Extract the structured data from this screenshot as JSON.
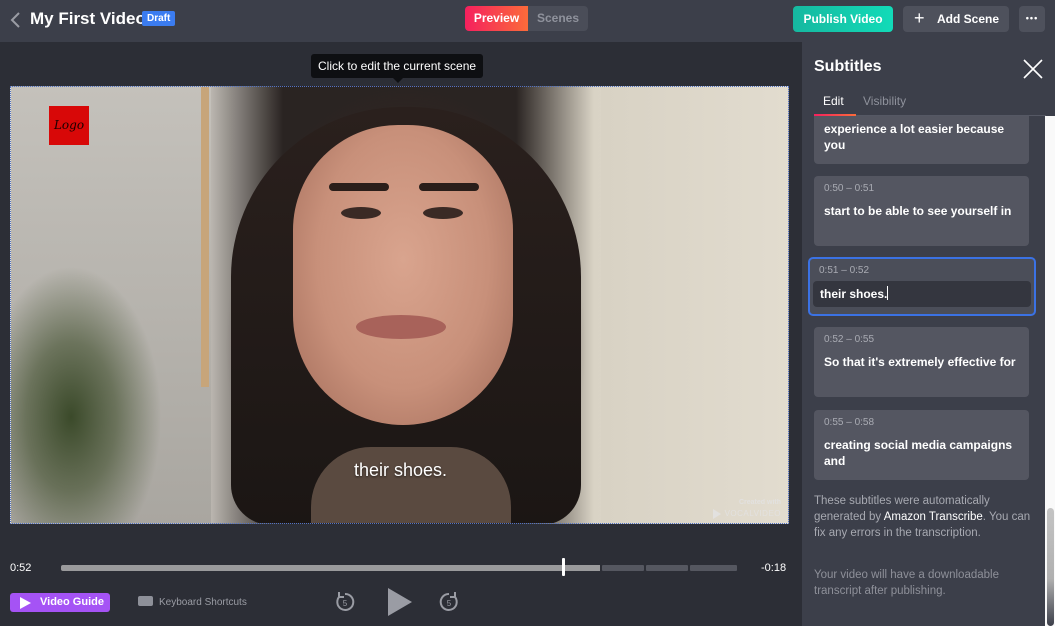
{
  "header": {
    "title": "My First Video",
    "status_badge": "Draft",
    "tabs": [
      {
        "label": "Preview",
        "active": true
      },
      {
        "label": "Scenes",
        "active": false
      }
    ],
    "publish_label": "Publish Video",
    "add_scene_label": "Add Scene",
    "more_label": "•••"
  },
  "stage": {
    "tooltip": "Click to edit the current scene",
    "video": {
      "logo_text": "Logo",
      "caption": "their shoes.",
      "watermark_line1": "Created with",
      "watermark_line2": "VOCALVIDEO"
    }
  },
  "player": {
    "current_time": "0:52",
    "remaining_time": "-0:18",
    "progress_fraction": 0.74,
    "rewind_seconds": "5",
    "forward_seconds": "5"
  },
  "footer": {
    "video_guide_label": "Video Guide",
    "keyboard_shortcuts_label": "Keyboard Shortcuts"
  },
  "subtitles_panel": {
    "title": "Subtitles",
    "tabs": [
      {
        "label": "Edit",
        "active": true
      },
      {
        "label": "Visibility",
        "active": false
      }
    ],
    "items": [
      {
        "time": "",
        "text": "experience a lot easier because you"
      },
      {
        "time": "0:50 – 0:51",
        "text": "start to be able to see yourself in"
      },
      {
        "time": "0:51 – 0:52",
        "text": "their shoes.",
        "active": true
      },
      {
        "time": "0:52 – 0:55",
        "text": "So that it's extremely effective for"
      },
      {
        "time": "0:55 – 0:58",
        "text": "creating social media campaigns and"
      }
    ],
    "note1_pre": "These subtitles were automatically generated by ",
    "note1_link": "Amazon Transcribe",
    "note1_post": ". You can fix any errors in the transcription.",
    "note2": "Your video will have a downloadable transcript after publishing."
  },
  "colors": {
    "accent_gradient_start": "#f5205e",
    "accent_gradient_end": "#fb6b3a",
    "publish": "#16b8a0",
    "draft_badge": "#3b7cf0",
    "video_guide": "#a553f5",
    "active_border": "#3b72e4"
  }
}
